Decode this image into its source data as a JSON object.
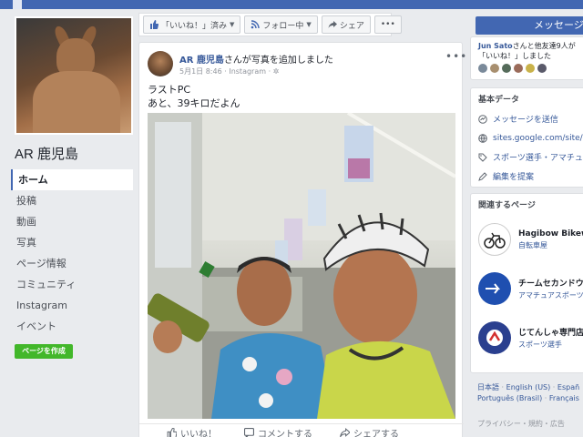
{
  "sidebar": {
    "page_name": "AR 鹿児島",
    "nav": [
      "ホーム",
      "投稿",
      "動画",
      "写真",
      "ページ情報",
      "コミュニティ",
      "Instagram",
      "イベント"
    ],
    "create_page": "ページを作成"
  },
  "actionbar": {
    "like": "「いいね！」済み",
    "follow": "フォロー中",
    "share": "シェア",
    "more": "•••",
    "message": "メッセージを送"
  },
  "post": {
    "author": "AR 鹿児島",
    "action": "さんが写真を追加しました",
    "date": "5月1日 8:46",
    "source": "Instagram",
    "more": "•••",
    "line1": "ラストPC",
    "line2": "あと、39キロだよん",
    "like": "いいね！",
    "comment": "コメントする",
    "share": "シェアする"
  },
  "right": {
    "friends_name": "Jun Sato",
    "friends_text": "さんと他友達9人が「いいね！」しました",
    "basic_title": "基本データ",
    "basic_rows": [
      {
        "icon": "messenger-icon",
        "text": "メッセージを送信"
      },
      {
        "icon": "globe-icon",
        "text": "sites.google.com/site/ar"
      },
      {
        "icon": "tag-icon",
        "text": "スポーツ選手・アマチュアスポ"
      },
      {
        "icon": "pencil-icon",
        "text": "編集を提案"
      }
    ],
    "related_title": "関連するページ",
    "related": [
      {
        "name": "Hagibow Bikew",
        "category": "自転車屋"
      },
      {
        "name": "チームセカンドウ",
        "category": "アマチュアスポーツ"
      },
      {
        "name": "じてんしゃ専門店",
        "category": "スポーツ選手"
      }
    ],
    "lang_line1": [
      "日本語",
      "English (US)",
      "Españ"
    ],
    "lang_line2": [
      "Português (Brasil)",
      "Français"
    ],
    "footer": "プライバシー・規約・広告"
  },
  "colors": {
    "brand": "#4267b2",
    "link": "#365899",
    "create_green": "#42b72a",
    "background": "#e9ebee"
  }
}
